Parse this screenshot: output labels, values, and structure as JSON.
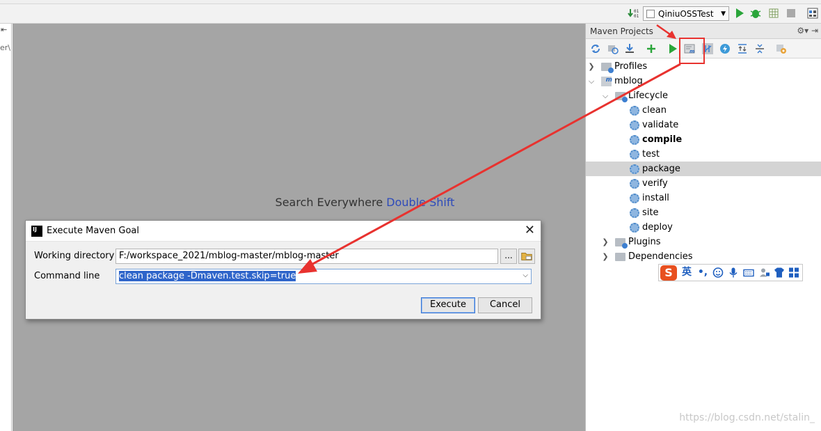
{
  "toolbar": {
    "run_config": "QiniuOSSTest",
    "colors": {
      "run": "#2aa53a",
      "debug": "#2aa53a",
      "stop": "#a0a0a0"
    }
  },
  "left_strip": {
    "collapse_glyph": "⇤",
    "cut_text": "er\\"
  },
  "editor": {
    "hint_text": "Search Everywhere",
    "hint_shortcut": "Double Shift"
  },
  "maven": {
    "title": "Maven Projects",
    "tree": {
      "profiles": "Profiles",
      "project": "mblog",
      "lifecycle": "Lifecycle",
      "goals": [
        "clean",
        "validate",
        "compile",
        "test",
        "package",
        "verify",
        "install",
        "site",
        "deploy"
      ],
      "bold_goal": "compile",
      "selected_goal": "package",
      "plugins": "Plugins",
      "dependencies": "Dependencies"
    }
  },
  "ime": {
    "logo": "S",
    "lang": "英",
    "punct": "•,"
  },
  "dialog": {
    "title": "Execute Maven Goal",
    "working_dir_label": "Working directory",
    "working_dir_value": "F:/workspace_2021/mblog-master/mblog-master",
    "command_line_label": "Command line",
    "command_line_value": "clean package -Dmaven.test.skip=true",
    "browse_label": "...",
    "execute_label": "Execute",
    "cancel_label": "Cancel",
    "close_glyph": "✕"
  },
  "watermark": "https://blog.csdn.net/stalin_",
  "annotation_color": "#e8322f"
}
